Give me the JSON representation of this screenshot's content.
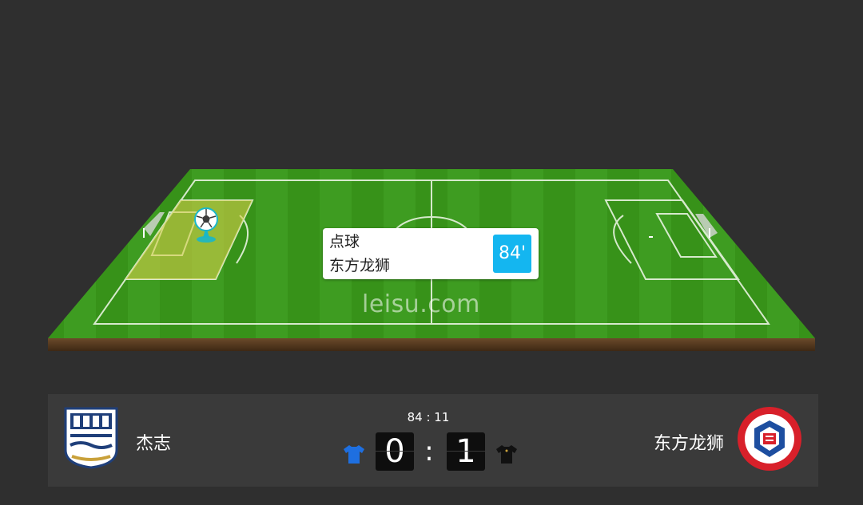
{
  "event": {
    "type": "点球",
    "team": "东方龙狮",
    "minute": "84'"
  },
  "watermark": "leisu.com",
  "match": {
    "clock": "84 : 11",
    "home": {
      "name": "杰志",
      "score": "0",
      "jersey_color": "#1e6fe0",
      "logo_name": "kitchee-logo"
    },
    "away": {
      "name": "东方龙狮",
      "score": "1",
      "jersey_color": "#111111",
      "logo_name": "eastern-sports-club-logo"
    },
    "separator": ":"
  },
  "colors": {
    "background": "#2f2f2f",
    "pitch_green": "#3c9a1f",
    "badge_blue": "#14b6f0",
    "penalty_highlight": "#c8c33a"
  },
  "icons": {
    "ball_marker": "ball-location-marker-icon"
  }
}
